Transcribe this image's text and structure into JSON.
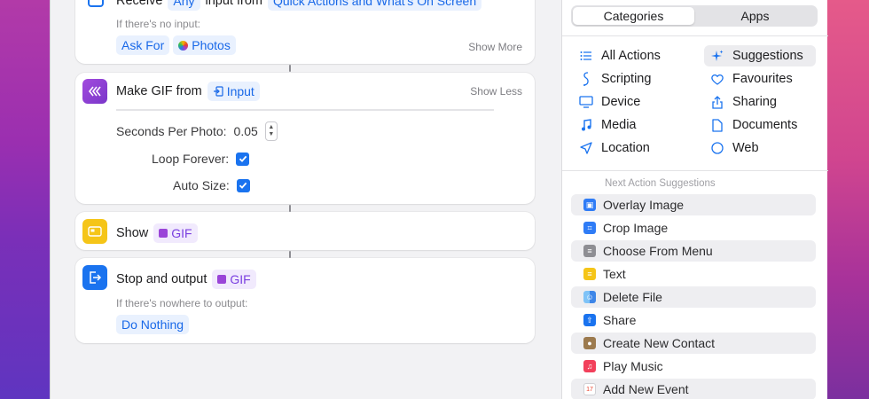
{
  "editor": {
    "receive": {
      "prefix": "Receive",
      "input_token": "Any",
      "middle": "input from",
      "source_token": "Quick Actions and What's On Screen",
      "no_input_label": "If there's no input:",
      "ask_for": "Ask For",
      "photos": "Photos",
      "show_more": "Show More"
    },
    "make_gif": {
      "title": "Make GIF from",
      "input_token": "Input",
      "show_less": "Show Less",
      "seconds_label": "Seconds Per Photo:",
      "seconds_value": "0.05",
      "loop_label": "Loop Forever:",
      "loop_checked": true,
      "auto_size_label": "Auto Size:",
      "auto_size_checked": true
    },
    "show": {
      "title": "Show",
      "token": "GIF"
    },
    "stop": {
      "title": "Stop and output",
      "token": "GIF",
      "nowhere_label": "If there's nowhere to output:",
      "do_nothing": "Do Nothing"
    }
  },
  "panel": {
    "tabs": [
      "Categories",
      "Apps"
    ],
    "active_tab": "Categories",
    "categories_left": [
      {
        "label": "All Actions",
        "icon": "list-icon"
      },
      {
        "label": "Scripting",
        "icon": "scripting-icon"
      },
      {
        "label": "Device",
        "icon": "device-icon"
      },
      {
        "label": "Media",
        "icon": "music-note-icon"
      },
      {
        "label": "Location",
        "icon": "location-arrow-icon"
      }
    ],
    "categories_right": [
      {
        "label": "Suggestions",
        "icon": "sparkles-icon"
      },
      {
        "label": "Favourites",
        "icon": "heart-icon"
      },
      {
        "label": "Sharing",
        "icon": "share-icon"
      },
      {
        "label": "Documents",
        "icon": "document-icon"
      },
      {
        "label": "Web",
        "icon": "globe-icon"
      }
    ],
    "suggestions_header": "Next Action Suggestions",
    "suggestions": [
      {
        "label": "Overlay Image",
        "color": "#2f7cf6",
        "icon": "overlay-image-icon"
      },
      {
        "label": "Crop Image",
        "color": "#2f7cf6",
        "icon": "crop-image-icon"
      },
      {
        "label": "Choose From Menu",
        "color": "#8e8e93",
        "icon": "menu-icon"
      },
      {
        "label": "Text",
        "color": "#f5c518",
        "icon": "text-icon"
      },
      {
        "label": "Delete File",
        "color": "#3e86e8",
        "icon": "finder-icon"
      },
      {
        "label": "Share",
        "color": "#1a73ef",
        "icon": "share-icon"
      },
      {
        "label": "Create New Contact",
        "color": "#9c7a4e",
        "icon": "contacts-icon"
      },
      {
        "label": "Play Music",
        "color": "#f2405b",
        "icon": "music-icon"
      },
      {
        "label": "Add New Event",
        "color": "#ffffff",
        "icon": "calendar-icon"
      }
    ]
  },
  "colors": {
    "accent_blue": "#1a73ef",
    "gif_purple": "#9a45d8",
    "show_yellow": "#f5c518",
    "stop_blue": "#1a73ef"
  }
}
